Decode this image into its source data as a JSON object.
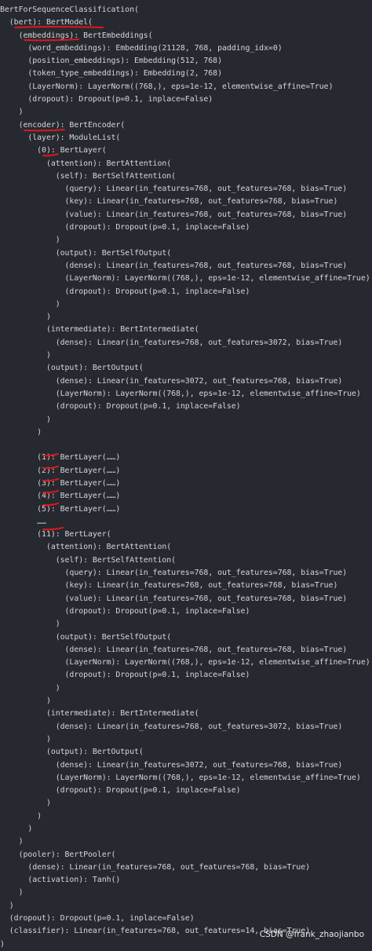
{
  "code_lines": [
    "BertForSequenceClassification(",
    "  (bert): BertModel(",
    "    (embeddings): BertEmbeddings(",
    "      (word_embeddings): Embedding(21128, 768, padding_idx=0)",
    "      (position_embeddings): Embedding(512, 768)",
    "      (token_type_embeddings): Embedding(2, 768)",
    "      (LayerNorm): LayerNorm((768,), eps=1e-12, elementwise_affine=True)",
    "      (dropout): Dropout(p=0.1, inplace=False)",
    "    )",
    "    (encoder): BertEncoder(",
    "      (layer): ModuleList(",
    "        (0): BertLayer(",
    "          (attention): BertAttention(",
    "            (self): BertSelfAttention(",
    "              (query): Linear(in_features=768, out_features=768, bias=True)",
    "              (key): Linear(in_features=768, out_features=768, bias=True)",
    "              (value): Linear(in_features=768, out_features=768, bias=True)",
    "              (dropout): Dropout(p=0.1, inplace=False)",
    "            )",
    "            (output): BertSelfOutput(",
    "              (dense): Linear(in_features=768, out_features=768, bias=True)",
    "              (LayerNorm): LayerNorm((768,), eps=1e-12, elementwise_affine=True)",
    "              (dropout): Dropout(p=0.1, inplace=False)",
    "            )",
    "          )",
    "          (intermediate): BertIntermediate(",
    "            (dense): Linear(in_features=768, out_features=3072, bias=True)",
    "          )",
    "          (output): BertOutput(",
    "            (dense): Linear(in_features=3072, out_features=768, bias=True)",
    "            (LayerNorm): LayerNorm((768,), eps=1e-12, elementwise_affine=True)",
    "            (dropout): Dropout(p=0.1, inplace=False)",
    "          )",
    "        )",
    "",
    "        (1): BertLayer(……)",
    "        (2): BertLayer(……)",
    "        (3): BertLayer(……)",
    "        (4): BertLayer(……)",
    "        (5): BertLayer(……)",
    "        ……",
    "        (11): BertLayer(",
    "          (attention): BertAttention(",
    "            (self): BertSelfAttention(",
    "              (query): Linear(in_features=768, out_features=768, bias=True)",
    "              (key): Linear(in_features=768, out_features=768, bias=True)",
    "              (value): Linear(in_features=768, out_features=768, bias=True)",
    "              (dropout): Dropout(p=0.1, inplace=False)",
    "            )",
    "            (output): BertSelfOutput(",
    "              (dense): Linear(in_features=768, out_features=768, bias=True)",
    "              (LayerNorm): LayerNorm((768,), eps=1e-12, elementwise_affine=True)",
    "              (dropout): Dropout(p=0.1, inplace=False)",
    "            )",
    "          )",
    "          (intermediate): BertIntermediate(",
    "            (dense): Linear(in_features=768, out_features=3072, bias=True)",
    "          )",
    "          (output): BertOutput(",
    "            (dense): Linear(in_features=3072, out_features=768, bias=True)",
    "            (LayerNorm): LayerNorm((768,), eps=1e-12, elementwise_affine=True)",
    "            (dropout): Dropout(p=0.1, inplace=False)",
    "          )",
    "        )",
    "      )",
    "    )",
    "    (pooler): BertPooler(",
    "      (dense): Linear(in_features=768, out_features=768, bias=True)",
    "      (activation): Tanh()",
    "    )",
    "  )",
    "  (dropout): Dropout(p=0.1, inplace=False)",
    "  (classifier): Linear(in_features=768, out_features=14, bias=True)",
    ")"
  ],
  "watermark": "CSDN @frank_zhaojianbo",
  "colors": {
    "background": "#262a30",
    "text": "#d4d6d9",
    "annotation": "#e0161e"
  }
}
